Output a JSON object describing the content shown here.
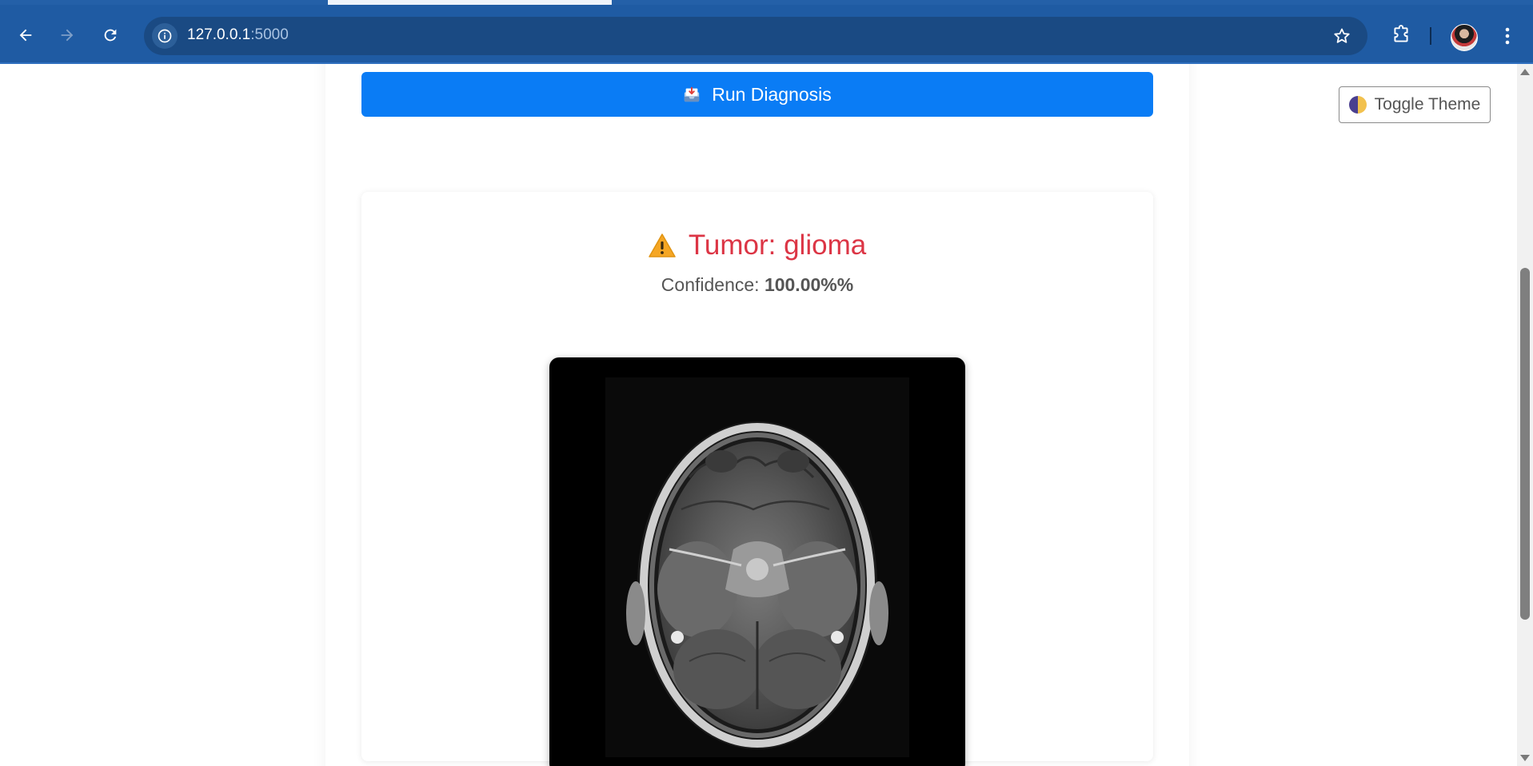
{
  "browser": {
    "url_host": "127.0.0.1",
    "url_port": ":5000",
    "icons": {
      "back": "arrow-left-icon",
      "forward": "arrow-right-icon",
      "reload": "reload-icon",
      "site_info": "info-icon",
      "bookmark": "star-icon",
      "extensions": "puzzle-icon",
      "profile": "avatar",
      "menu": "kebab-menu-icon"
    },
    "colors": {
      "toolbar": "#1f5ba3",
      "omnibox": "#1a4a83"
    }
  },
  "page": {
    "run_button_label": "Run Diagnosis",
    "toggle_theme_label": "Toggle Theme",
    "result": {
      "title": "Tumor: glioma",
      "confidence_label": "Confidence: ",
      "confidence_value": "100.00%%",
      "image_alt": "Brain MRI scan"
    },
    "colors": {
      "primary": "#0a7cf5",
      "danger": "#dc3545",
      "warning": "#f5a623"
    }
  }
}
